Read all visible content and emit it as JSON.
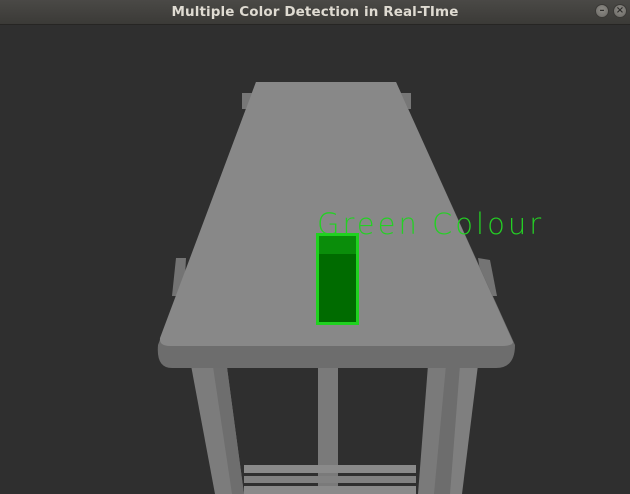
{
  "window": {
    "title": "Multiple Color Detection in Real-TIme",
    "buttons": {
      "minimize_icon": "minimize-icon",
      "close_icon": "close-icon"
    }
  },
  "scene": {
    "detections": [
      {
        "label": "Green Colour",
        "box_color": "#1fd21f",
        "object_color": "#006b00"
      }
    ]
  },
  "colors": {
    "background": "#2f2f2f",
    "table_top": "#878787",
    "table_edge": "#6f6f6f",
    "legs": "#7b7b7b",
    "label": "#24d024"
  }
}
